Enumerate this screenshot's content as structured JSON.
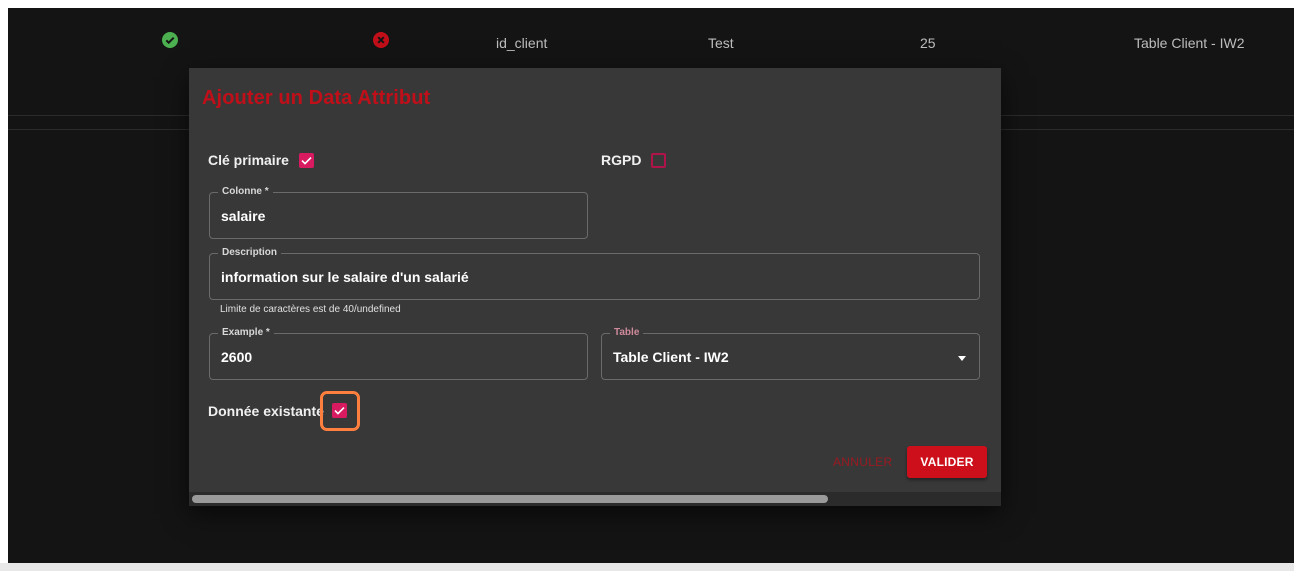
{
  "background_row": {
    "status_ok_icon": "check-circle-icon",
    "status_error_icon": "x-circle-icon",
    "column": "id_client",
    "example": "Test",
    "length": "25",
    "table": "Table Client - IW2"
  },
  "dialog": {
    "title": "Ajouter un Data Attribut",
    "primary_key": {
      "label": "Clé primaire",
      "checked": true
    },
    "rgpd": {
      "label": "RGPD",
      "checked": false
    },
    "colonne": {
      "label": "Colonne *",
      "value": "salaire"
    },
    "description": {
      "label": "Description",
      "value": "information sur le salaire d'un salarié",
      "helper": "Limite de caractères est de 40/undefined"
    },
    "example": {
      "label": "Example *",
      "value": "2600"
    },
    "table": {
      "label": "Table",
      "value": "Table Client - IW2"
    },
    "existing_data": {
      "label": "Donnée existante",
      "checked": true
    },
    "cancel_label": "ANNULER",
    "submit_label": "VALIDER"
  },
  "colors": {
    "accent": "#c00f19",
    "checkbox": "#d81b60",
    "highlight": "#ff7f3f",
    "ok": "#4caf50",
    "error": "#c00f19"
  }
}
